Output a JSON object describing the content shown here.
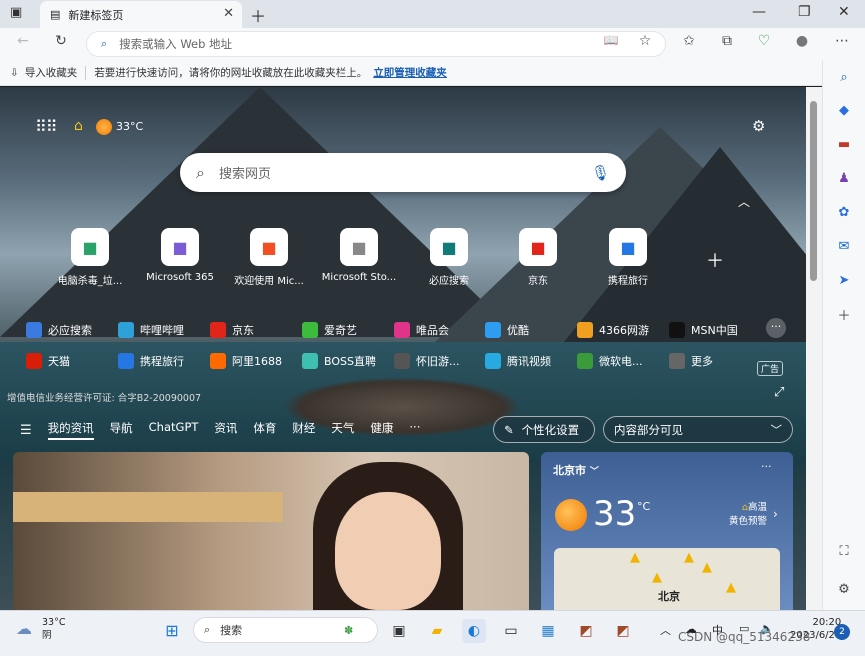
{
  "browser": {
    "tab_title": "新建标签页",
    "address_placeholder": "搜索或输入 Web 地址"
  },
  "favbar": {
    "import": "导入收藏夹",
    "hint": "若要进行快速访问，请将你的网址收藏放在此收藏夹栏上。",
    "manage_link": "立即管理收藏夹"
  },
  "header": {
    "temp": "33°C"
  },
  "search": {
    "placeholder": "搜索网页"
  },
  "quicklinks": [
    {
      "label": "电脑杀毒_垃...",
      "icon": "leaf-icon",
      "color": "#2aa36b"
    },
    {
      "label": "Microsoft 365",
      "icon": "m365-icon",
      "color": "#7b5cd6"
    },
    {
      "label": "欢迎使用 Mic...",
      "icon": "windows-logo-icon",
      "color": "#f25022"
    },
    {
      "label": "Microsoft Sto...",
      "icon": "store-icon",
      "color": "#888888"
    },
    {
      "label": "必应搜索",
      "icon": "bing-icon",
      "color": "#0f7c7a"
    },
    {
      "label": "京东",
      "icon": "jd-icon",
      "color": "#e1251b"
    },
    {
      "label": "携程旅行",
      "icon": "ctrip-icon",
      "color": "#2577e3"
    }
  ],
  "links_row1": [
    {
      "label": "必应搜索",
      "color": "#3b7be0"
    },
    {
      "label": "哔哩哔哩",
      "color": "#2fa1d9"
    },
    {
      "label": "京东",
      "color": "#e1251b"
    },
    {
      "label": "爱奇艺",
      "color": "#3dbb3d"
    },
    {
      "label": "唯品会",
      "color": "#e0338a"
    },
    {
      "label": "优酷",
      "color": "#2e9cf0"
    },
    {
      "label": "4366网游",
      "color": "#f0a020"
    },
    {
      "label": "MSN中国",
      "color": "#111111"
    }
  ],
  "links_row2": [
    {
      "label": "天猫",
      "color": "#d81e06"
    },
    {
      "label": "携程旅行",
      "color": "#2577e3"
    },
    {
      "label": "阿里1688",
      "color": "#ff6a00"
    },
    {
      "label": "BOSS直聘",
      "color": "#3fbfae"
    },
    {
      "label": "怀旧游...",
      "color": "#555555"
    },
    {
      "label": "腾讯视频",
      "color": "#27a9e1"
    },
    {
      "label": "微软电...",
      "color": "#3a9b3a"
    },
    {
      "label": "更多",
      "color": "#666666"
    }
  ],
  "ad_badge": "广告",
  "license": "增值电信业务经营许可证: 合字B2-20090007",
  "feed_nav": {
    "tabs": [
      "我的资讯",
      "导航",
      "ChatGPT",
      "资讯",
      "体育",
      "财经",
      "天气",
      "健康",
      "···"
    ],
    "personalize": "个性化设置",
    "visibility": "内容部分可见"
  },
  "weather": {
    "city": "北京市",
    "temp": "33",
    "unit": "°C",
    "alert": "高温",
    "alert_level": "黄色预警",
    "map_label": "北京"
  },
  "taskbar": {
    "temp": "33°C",
    "condition": "阴",
    "search": "搜索",
    "ime": "中",
    "time": "20:20",
    "date": "2023/6/28",
    "watermark": "CSDN @qq_51346238",
    "notif": "2"
  }
}
